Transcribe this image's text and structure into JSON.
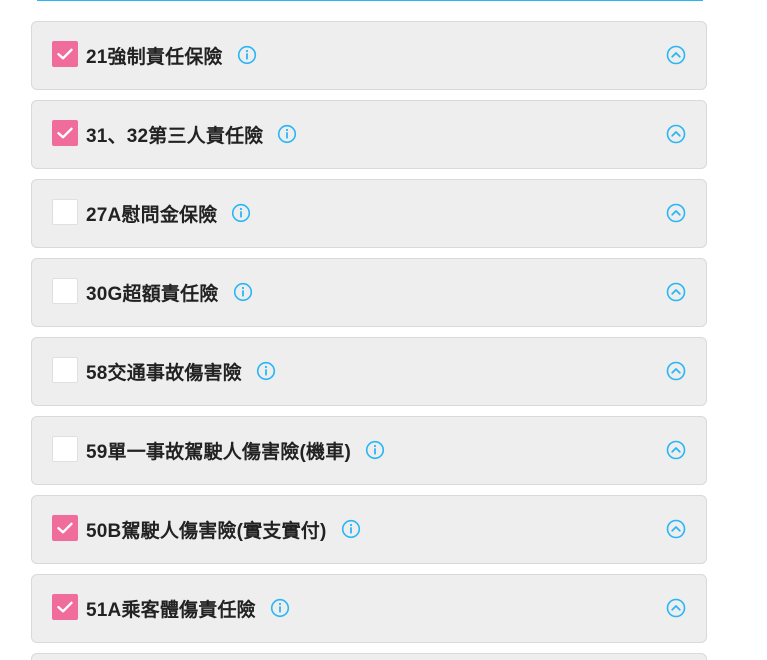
{
  "colors": {
    "accent": "#29b6f6",
    "checked": "#f06c9b",
    "card_bg": "#eeeeee",
    "text": "#222222"
  },
  "insurance_items": [
    {
      "label": "21強制責任保險",
      "checked": true
    },
    {
      "label": "31、32第三人責任險",
      "checked": true
    },
    {
      "label": "27A慰問金保險",
      "checked": false
    },
    {
      "label": "30G超額責任險",
      "checked": false
    },
    {
      "label": "58交通事故傷害險",
      "checked": false
    },
    {
      "label": "59單一事故駕駛人傷害險(機車)",
      "checked": false
    },
    {
      "label": "50B駕駛人傷害險(實支實付)",
      "checked": true
    },
    {
      "label": "51A乘客體傷責任險",
      "checked": true
    }
  ],
  "icons": {
    "info": "info-circle-icon",
    "expand": "chevron-up-circle-icon",
    "check": "checkmark-icon"
  }
}
